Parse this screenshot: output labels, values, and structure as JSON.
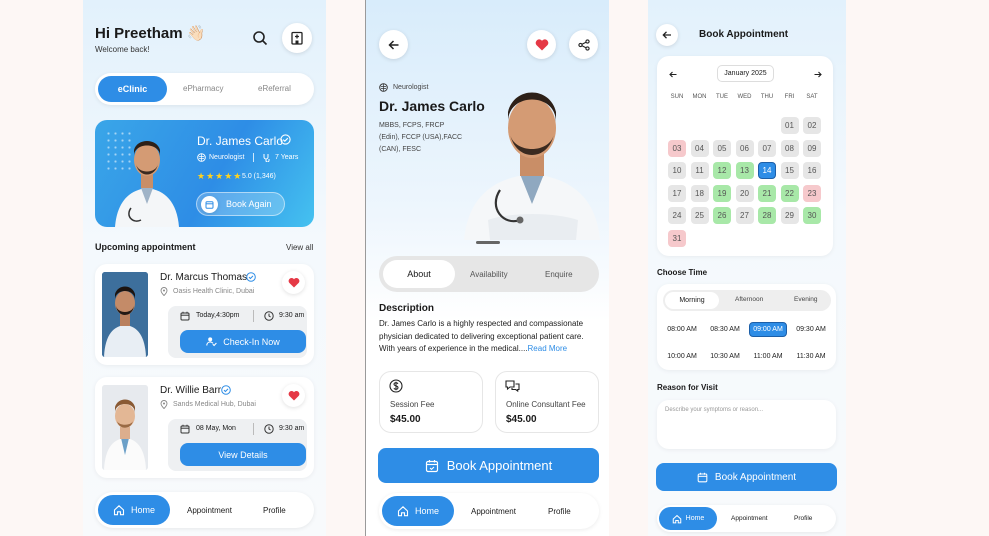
{
  "colors": {
    "primary": "#2e8de6",
    "bg": "#fdf7f5",
    "available": "#a8e8a8",
    "unavailable": "#f6c9cc",
    "neutral": "#e6e6e6",
    "heart": "#e53946"
  },
  "home": {
    "greeting": "Hi Preetham 👋🏻",
    "welcome": "Welcome back!",
    "tabs": [
      "eClinic",
      "ePharmacy",
      "eReferral"
    ],
    "featured": {
      "name": "Dr. James Carlo",
      "specialty": "Neurologist",
      "experience": "7 Years",
      "rating": "5.0 (1,346)",
      "stars": 5,
      "button": "Book Again"
    },
    "upcoming_title": "Upcoming appointment",
    "view_all": "View all",
    "appointments": [
      {
        "name": "Dr. Marcus Thomas",
        "location": "Oasis Health Clinic, Dubai",
        "date": "Today,4:30pm",
        "time": "9:30 am",
        "button": "Check-In Now"
      },
      {
        "name": "Dr. Willie Barr",
        "location": "Sands Medical Hub, Dubai",
        "date": "08 May, Mon",
        "time": "9:30 am",
        "button": "View Details"
      }
    ],
    "nav": [
      "Home",
      "Appointment",
      "Profile"
    ]
  },
  "detail": {
    "specialty": "Neurologist",
    "name": "Dr. James Carlo",
    "qualifications": [
      "MBBS, FCPS, FRCP",
      "(Edin), FCCP (USA),FACC",
      "(CAN), FESC"
    ],
    "tabs": [
      "About",
      "Availability",
      "Enquire"
    ],
    "description_title": "Description",
    "description": "Dr. James Carlo is a highly respected and compassionate physician dedicated to delivering exceptional patient care. With years of experience in the medical....",
    "read_more": "Read More",
    "fees": [
      {
        "label": "Session Fee",
        "value": "$45.00"
      },
      {
        "label": "Online Consultant Fee",
        "value": "$45.00"
      }
    ],
    "button": "Book Appointment",
    "nav": [
      "Home",
      "Appointment",
      "Profile"
    ]
  },
  "booking": {
    "title": "Book Appointment",
    "month": "January 2025",
    "weekdays": [
      "SUN",
      "MON",
      "TUE",
      "WED",
      "THU",
      "FRI",
      "SAT"
    ],
    "days": [
      {
        "d": "01",
        "s": "n"
      },
      {
        "d": "02",
        "s": "n"
      },
      {
        "d": "03",
        "s": "u"
      },
      {
        "d": "04",
        "s": "n"
      },
      {
        "d": "05",
        "s": "n"
      },
      {
        "d": "06",
        "s": "n"
      },
      {
        "d": "07",
        "s": "n"
      },
      {
        "d": "08",
        "s": "n"
      },
      {
        "d": "09",
        "s": "n"
      },
      {
        "d": "10",
        "s": "n"
      },
      {
        "d": "11",
        "s": "n"
      },
      {
        "d": "12",
        "s": "a"
      },
      {
        "d": "13",
        "s": "a"
      },
      {
        "d": "14",
        "s": "sel"
      },
      {
        "d": "15",
        "s": "n"
      },
      {
        "d": "16",
        "s": "n"
      },
      {
        "d": "17",
        "s": "n"
      },
      {
        "d": "18",
        "s": "n"
      },
      {
        "d": "19",
        "s": "a"
      },
      {
        "d": "20",
        "s": "n"
      },
      {
        "d": "21",
        "s": "a"
      },
      {
        "d": "22",
        "s": "a"
      },
      {
        "d": "23",
        "s": "u"
      },
      {
        "d": "24",
        "s": "n"
      },
      {
        "d": "25",
        "s": "n"
      },
      {
        "d": "26",
        "s": "a"
      },
      {
        "d": "27",
        "s": "n"
      },
      {
        "d": "28",
        "s": "a"
      },
      {
        "d": "29",
        "s": "n"
      },
      {
        "d": "30",
        "s": "a"
      },
      {
        "d": "31",
        "s": "u"
      }
    ],
    "choose_time": "Choose Time",
    "periods": [
      "Morning",
      "Afternoon",
      "Evening"
    ],
    "slots": [
      "08:00 AM",
      "08:30 AM",
      "09:00 AM",
      "09:30 AM",
      "10:00 AM",
      "10:30 AM",
      "11:00 AM",
      "11:30 AM"
    ],
    "selected_slot": "09:00 AM",
    "reason_title": "Reason for Visit",
    "reason_placeholder": "Describe your symptoms or reason...",
    "button": "Book Appointment",
    "nav": [
      "Home",
      "Appointment",
      "Profile"
    ]
  }
}
